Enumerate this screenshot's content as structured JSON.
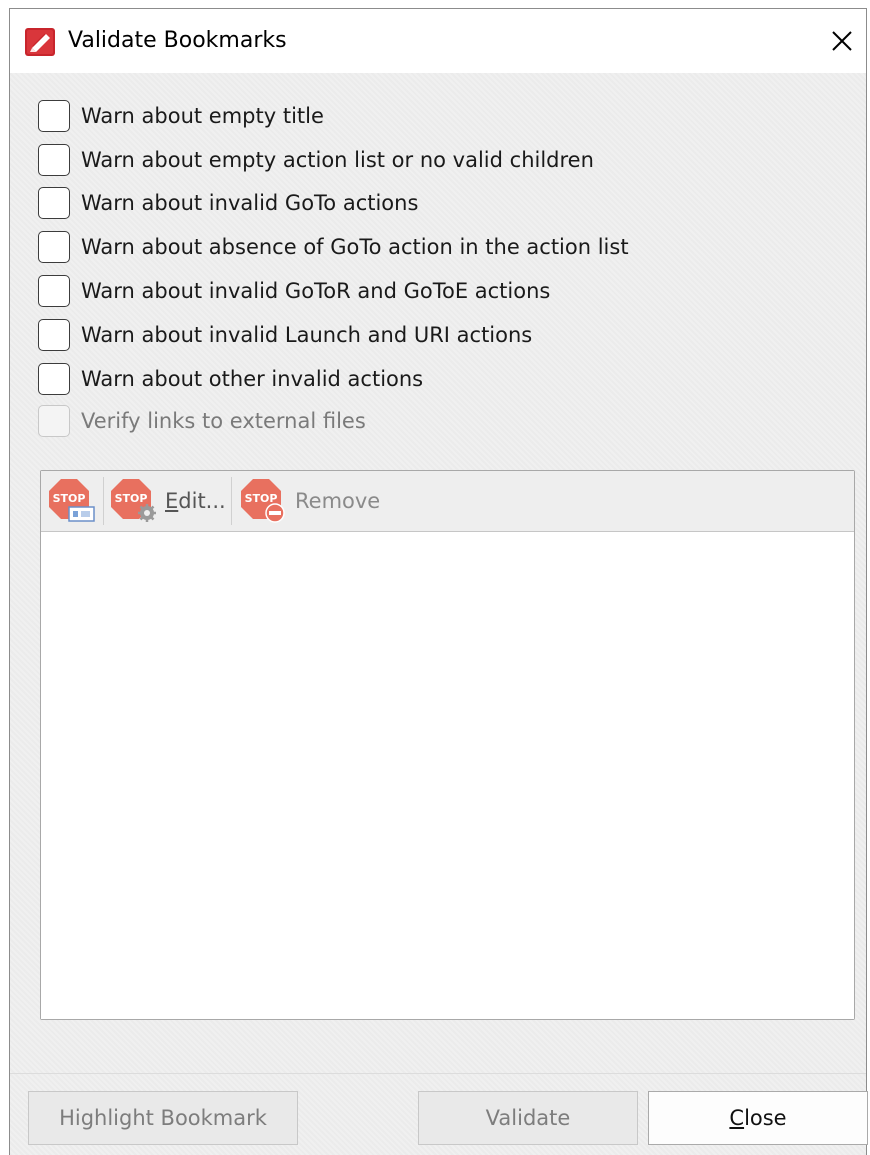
{
  "window": {
    "title": "Validate Bookmarks"
  },
  "options": [
    {
      "label": "Warn about empty title",
      "checked": false,
      "enabled": true
    },
    {
      "label": "Warn about empty action list or no valid children",
      "checked": false,
      "enabled": true
    },
    {
      "label": "Warn about invalid GoTo actions",
      "checked": false,
      "enabled": true
    },
    {
      "label": "Warn about absence of GoTo action in the action list",
      "checked": false,
      "enabled": true
    },
    {
      "label": "Warn about invalid GoToR and GoToE actions",
      "checked": false,
      "enabled": true
    },
    {
      "label": "Warn about invalid Launch and URI actions",
      "checked": false,
      "enabled": true
    },
    {
      "label": "Warn about other invalid actions",
      "checked": false,
      "enabled": true
    },
    {
      "label": "Verify links to external files",
      "checked": false,
      "enabled": false
    }
  ],
  "toolbar": {
    "add_icon": "stop-sign-add-icon",
    "edit_icon": "stop-sign-gear-icon",
    "edit_label": "Edit...",
    "edit_mnemonic": "E",
    "edit_rest": "dit...",
    "remove_icon": "stop-sign-remove-icon",
    "remove_label": "Remove"
  },
  "buttons": {
    "highlight": "Highlight Bookmark",
    "validate": "Validate",
    "close": "Close",
    "close_mnemonic": "C",
    "close_rest": "lose"
  },
  "colors": {
    "stop_red": "#e8705f",
    "brand_red": "#c8252c"
  }
}
